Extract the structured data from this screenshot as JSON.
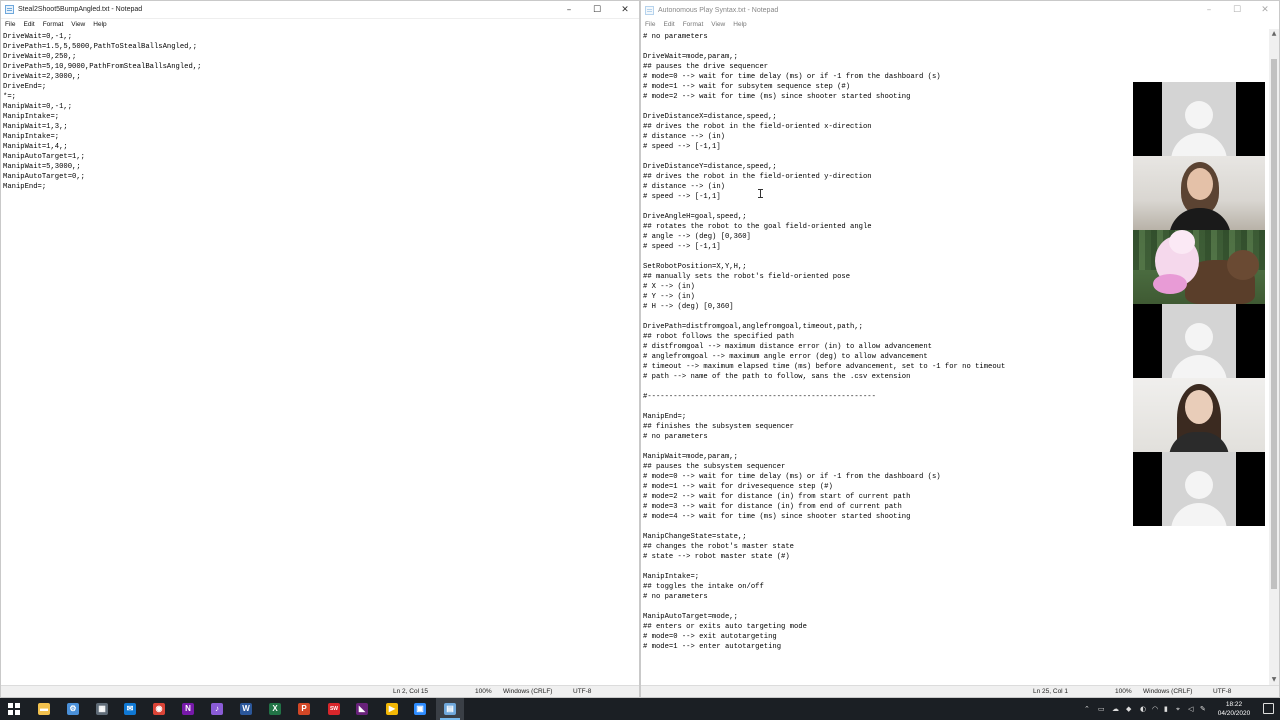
{
  "left_window": {
    "title": "Steal2Shoot5BumpAngled.txt - Notepad",
    "menu": [
      "File",
      "Edit",
      "Format",
      "View",
      "Help"
    ],
    "lines": [
      "DriveWait=0,-1,;",
      "DrivePath=1.5,5,5000,PathToStealBallsAngled,;",
      "DriveWait=0,250,;",
      "DrivePath=5,10,9000,PathFromStealBallsAngled,;",
      "DriveWait=2,3000,;",
      "DriveEnd=;",
      "*=;",
      "ManipWait=0,-1,;",
      "ManipIntake=;",
      "ManipWait=1,3,;",
      "ManipIntake=;",
      "ManipWait=1,4,;",
      "ManipAutoTarget=1,;",
      "ManipWait=5,3000,;",
      "ManipAutoTarget=0,;",
      "ManipEnd=;"
    ],
    "status": {
      "position": "Ln 2, Col 15",
      "zoom": "100%",
      "line_ending": "Windows (CRLF)",
      "encoding": "UTF-8"
    }
  },
  "right_window": {
    "title": "Autonomous Play Syntax.txt - Notepad",
    "menu": [
      "File",
      "Edit",
      "Format",
      "View",
      "Help"
    ],
    "lines": [
      "# no parameters",
      "",
      "DriveWait=mode,param,;",
      "## pauses the drive sequencer",
      "# mode=0 --> wait for time delay (ms) or if -1 from the dashboard (s)",
      "# mode=1 --> wait for subsytem sequence step (#)",
      "# mode=2 --> wait for time (ms) since shooter started shooting",
      "",
      "DriveDistanceX=distance,speed,;",
      "## drives the robot in the field-oriented x-direction",
      "# distance --> (in)",
      "# speed --> [-1,1]",
      "",
      "DriveDistanceY=distance,speed,;",
      "## drives the robot in the field-oriented y-direction",
      "# distance --> (in)",
      "# speed --> [-1,1]",
      "",
      "DriveAngleH=goal,speed,;",
      "## rotates the robot to the goal field-oriented angle",
      "# angle --> (deg) [0,360]",
      "# speed --> [-1,1]",
      "",
      "SetRobotPosition=X,Y,H,;",
      "## manually sets the robot's field-oriented pose",
      "# X --> (in)",
      "# Y --> (in)",
      "# H --> (deg) [0,360]",
      "",
      "DrivePath=distfromgoal,anglefromgoal,timeout,path,;",
      "## robot follows the specified path",
      "# distfromgoal --> maximum distance error (in) to allow advancement",
      "# anglefromgoal --> maximum angle error (deg) to allow advancement",
      "# timeout --> maximum elapsed time (ms) before advancement, set to -1 for no timeout",
      "# path --> name of the path to follow, sans the .csv extension",
      "",
      "#-----------------------------------------------------",
      "",
      "ManipEnd=;",
      "## finishes the subsystem sequencer",
      "# no parameters",
      "",
      "ManipWait=mode,param,;",
      "## pauses the subsystem sequencer",
      "# mode=0 --> wait for time delay (ms) or if -1 from the dashboard (s)",
      "# mode=1 --> wait for drivesequence step (#)",
      "# mode=2 --> wait for distance (in) from start of current path",
      "# mode=3 --> wait for distance (in) from end of current path",
      "# mode=4 --> wait for time (ms) since shooter started shooting",
      "",
      "ManipChangeState=state,;",
      "## changes the robot's master state",
      "# state --> robot master state (#)",
      "",
      "ManipIntake=;",
      "## toggles the intake on/off",
      "# no parameters",
      "",
      "ManipAutoTarget=mode,;",
      "## enters or exits auto targeting mode",
      "# mode=0 --> exit autotargeting",
      "# mode=1 --> enter autotargeting"
    ],
    "status": {
      "position": "Ln 25, Col 1",
      "zoom": "100%",
      "line_ending": "Windows (CRLF)",
      "encoding": "UTF-8"
    }
  },
  "window_controls": {
    "minimize": "–",
    "maximize": "☐",
    "close": "✕"
  },
  "video_tiles": [
    {
      "type": "avatar-placeholder"
    },
    {
      "type": "camera-woman-dark-hair"
    },
    {
      "type": "virtual-background-bear"
    },
    {
      "type": "avatar-placeholder"
    },
    {
      "type": "camera-woman-long-hair"
    },
    {
      "type": "avatar-placeholder"
    }
  ],
  "taskbar": {
    "pinned": [
      {
        "name": "file-explorer-icon",
        "glyph": "▬",
        "color": "#f2c14e"
      },
      {
        "name": "settings-icon",
        "glyph": "⚙",
        "color": "#4a90d9"
      },
      {
        "name": "calculator-icon",
        "glyph": "▦",
        "color": "#5f6b77"
      },
      {
        "name": "mail-icon",
        "glyph": "✉",
        "color": "#0f78d4"
      },
      {
        "name": "chrome-icon",
        "glyph": "◉",
        "color": "#db4437"
      },
      {
        "name": "onenote-icon",
        "glyph": "N",
        "color": "#7719aa"
      },
      {
        "name": "audio-app-icon",
        "glyph": "♪",
        "color": "#8a5cd6"
      },
      {
        "name": "word-icon",
        "glyph": "W",
        "color": "#2b579a"
      },
      {
        "name": "excel-icon",
        "glyph": "X",
        "color": "#217346"
      },
      {
        "name": "powerpoint-icon",
        "glyph": "P",
        "color": "#d24726"
      },
      {
        "name": "solidworks-icon",
        "glyph": "SW",
        "color": "#d8262b"
      },
      {
        "name": "visual-studio-icon",
        "glyph": "◣",
        "color": "#68217a"
      },
      {
        "name": "power-automate-icon",
        "glyph": "▶",
        "color": "#f2b705"
      },
      {
        "name": "zoom-icon",
        "glyph": "▣",
        "color": "#2d8cff"
      },
      {
        "name": "notepad-icon",
        "glyph": "▤",
        "color": "#6fa8dc"
      }
    ],
    "clock_time": "18:22",
    "clock_date": "04/20/2020"
  }
}
